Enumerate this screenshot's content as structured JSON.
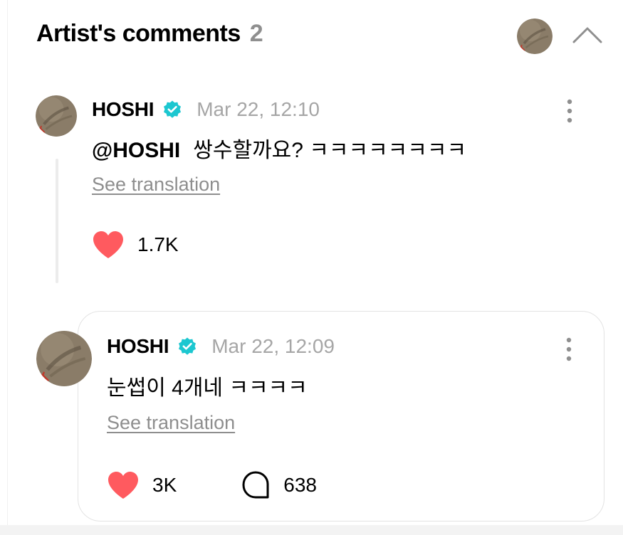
{
  "header": {
    "title": "Artist's comments",
    "count": "2"
  },
  "icons": {
    "collapse": "chevron-up-icon",
    "verified": "verified-badge-icon",
    "like": "heart-icon",
    "reply": "speech-bubble-icon",
    "more": "more-vertical-icon"
  },
  "colors": {
    "verified": "#1cc7d0",
    "heart": "#ff5a5f",
    "muted_text": "#8e8e8e",
    "timestamp": "#a6a6a6"
  },
  "comments": [
    {
      "author": "HOSHI",
      "timestamp": "Mar 22, 12:10",
      "mention": "@HOSHI",
      "text": "쌍수할까요? ㅋㅋㅋㅋㅋㅋㅋㅋ",
      "see_translation": "See translation",
      "likes": "1.7K"
    },
    {
      "author": "HOSHI",
      "timestamp": "Mar 22, 12:09",
      "text": "눈썹이 4개네 ㅋㅋㅋㅋ",
      "see_translation": "See translation",
      "likes": "3K",
      "replies": "638"
    }
  ]
}
